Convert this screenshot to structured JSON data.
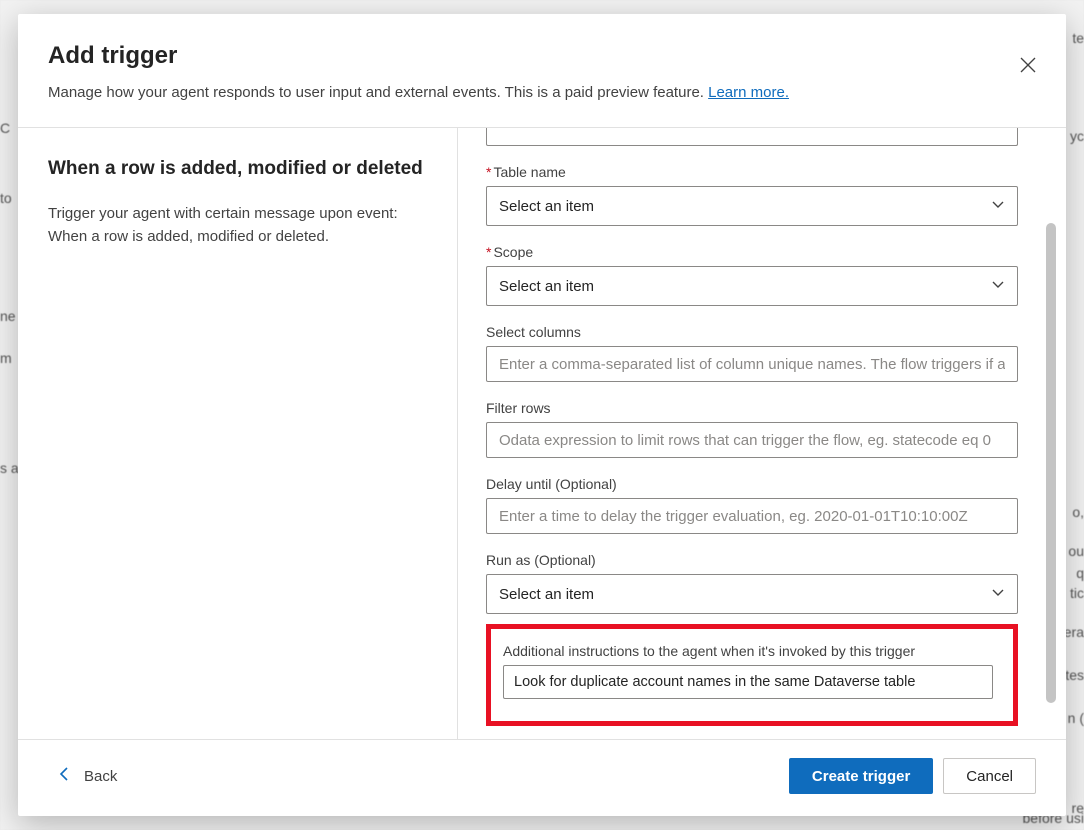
{
  "header": {
    "title": "Add trigger",
    "subtitle_pre": "Manage how your agent responds to user input and external events. This is a paid preview feature. ",
    "learn_more": "Learn more."
  },
  "left": {
    "title": "When a row is added, modified or deleted",
    "desc": "Trigger your agent with certain message upon event: When a row is added, modified or deleted."
  },
  "form": {
    "table_name": {
      "label": "Table name",
      "value": "Select an item"
    },
    "scope": {
      "label": "Scope",
      "value": "Select an item"
    },
    "select_columns": {
      "label": "Select columns",
      "placeholder": "Enter a comma-separated list of column unique names. The flow triggers if any of t"
    },
    "filter_rows": {
      "label": "Filter rows",
      "placeholder": "Odata expression to limit rows that can trigger the flow, eg. statecode eq 0"
    },
    "delay_until": {
      "label": "Delay until (Optional)",
      "placeholder": "Enter a time to delay the trigger evaluation, eg. 2020-01-01T10:10:00Z"
    },
    "run_as": {
      "label": "Run as (Optional)",
      "value": "Select an item"
    },
    "instructions": {
      "label": "Additional instructions to the agent when it's invoked by this trigger",
      "value": "Look for duplicate account names in the same Dataverse table"
    }
  },
  "footer": {
    "back": "Back",
    "create": "Create trigger",
    "cancel": "Cancel"
  },
  "bg_fragments": {
    "a": "C",
    "b": "to",
    "c": "ne",
    "d": "m",
    "e": "s a",
    "f": "te",
    "g": "o,",
    "h": "ou",
    "i": " q",
    "j": "tic",
    "k": "era",
    "l": "tes",
    "m": "n (",
    "n": "re",
    "o": "before usi",
    "p": "yc"
  }
}
